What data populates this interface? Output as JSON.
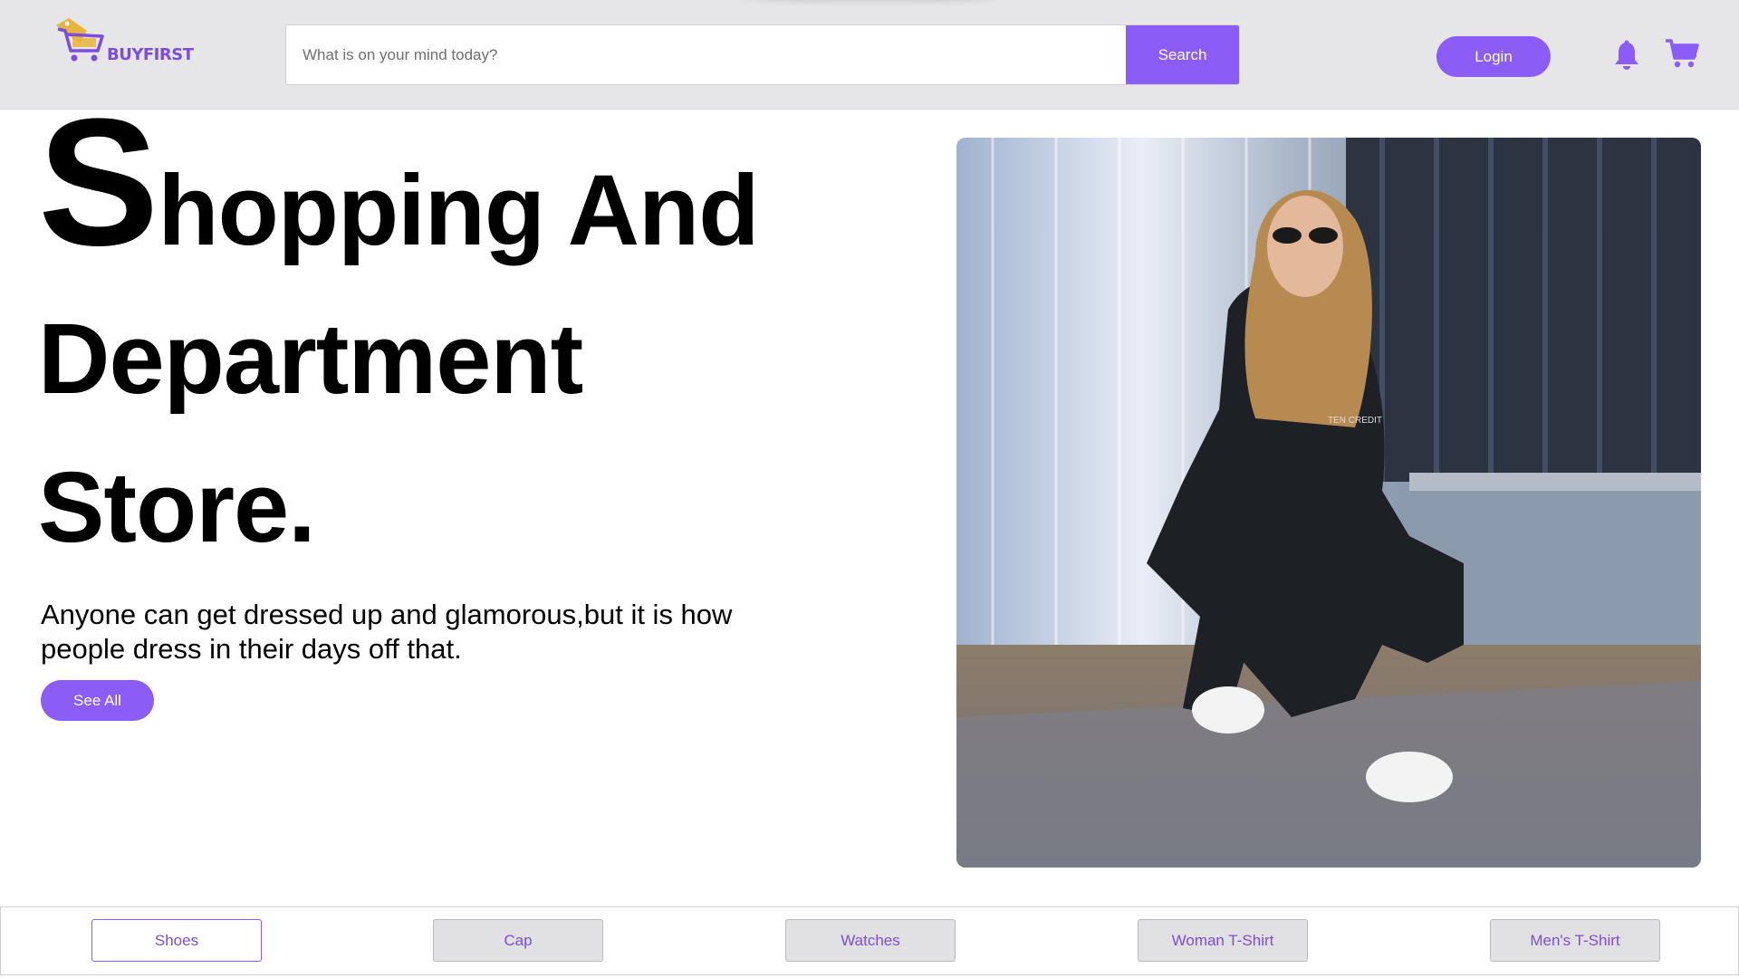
{
  "header": {
    "logo_text": "BUYFIRST",
    "search": {
      "placeholder": "What is on your mind today?",
      "value": "",
      "button_label": "Search"
    },
    "login_label": "Login",
    "icons": [
      "bell-icon",
      "cart-icon"
    ]
  },
  "hero": {
    "title_initial": "S",
    "title_rest_line1": "hopping And",
    "title_line2": "Department",
    "title_line3": "Store.",
    "description": "Anyone can get dressed up and glamorous,but it is how people dress in their days off that.",
    "see_all_label": "See All",
    "image_overlay_text": "TEN CREDIT"
  },
  "categories": {
    "active": "Shoes",
    "items": [
      "Shoes",
      "Cap",
      "Watches",
      "Woman T-Shirt",
      "Men's T-Shirt"
    ]
  },
  "colors": {
    "accent": "#8b5cf6",
    "header_bg": "#e6e6e8",
    "logo_yellow": "#e8b53c"
  }
}
